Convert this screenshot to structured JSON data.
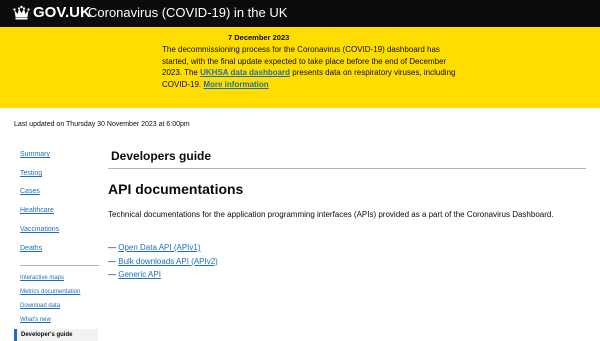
{
  "header": {
    "logo_text": "GOV.UK",
    "service_name": "Coronavirus (COVID-19) in the UK"
  },
  "banner": {
    "date": "7 December 2023",
    "text_part1": "The decommissioning process for the Coronavirus (COVID-19) dashboard has started, with the final update expected to take place before the end of December 2023. The ",
    "link1": "UKHSA data dashboard",
    "text_part2": " presents data on respiratory viruses, including COVID-19. ",
    "link2": "More information"
  },
  "last_updated": "Last updated on Thursday 30 November 2023 at 6:00pm",
  "nav": {
    "primary": [
      "Summary",
      "Testing",
      "Cases",
      "Healthcare",
      "Vaccinations",
      "Deaths"
    ],
    "secondary": [
      "Interactive maps",
      "Metrics documentation",
      "Download data",
      "What's new"
    ],
    "active": "Developer's guide"
  },
  "main": {
    "page_title": "Developers guide",
    "section_title": "API documentations",
    "intro": "Technical documentations for the application programming interfaces (APIs) provided as a part of the Coronavirus Dashboard.",
    "dash": "—",
    "links": [
      "Open Data API (APIv1)",
      "Bulk downloads API (APIv2)",
      "Generic API"
    ]
  },
  "colors": {
    "header_bg": "#0b0c0c",
    "banner_bg": "#ffdd00",
    "link": "#1d70b8",
    "divider": "#b1b4b6"
  }
}
